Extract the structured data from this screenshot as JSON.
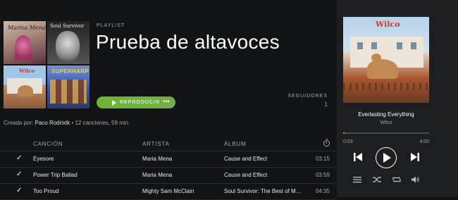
{
  "playlist": {
    "type_label": "PLAYLIST",
    "title": "Prueba de altavoces",
    "play_label": "REPRODUCIR",
    "more_label": "•••",
    "followers_label": "SEGUIDORES",
    "followers_count": "1",
    "created_prefix": "Creada por:",
    "owner": "Paco Rodrixtk",
    "summary": "• 12 canciones, 59 min",
    "covers": [
      {
        "text": "Marisa Mena"
      },
      {
        "text": "Soul Survivor"
      },
      {
        "text": "Wilco"
      },
      {
        "text": "SUPERHARPS"
      }
    ]
  },
  "table": {
    "headers": {
      "song": "CANCIÓN",
      "artist": "ARTISTA",
      "album": "ÁLBUM"
    },
    "rows": [
      {
        "check": "✓",
        "song": "Eyesore",
        "artist": "Maria Mena",
        "album": "Cause and Effect",
        "duration": "03:15"
      },
      {
        "check": "✓",
        "song": "Power Trip Ballad",
        "artist": "Maria Mena",
        "album": "Cause and Effect",
        "duration": "03:59"
      },
      {
        "check": "✓",
        "song": "Too Proud",
        "artist": "Mighty Sam McClain",
        "album": "Soul Survivor: The Best of M...",
        "duration": "04:35"
      }
    ]
  },
  "now_playing": {
    "art_logo": "Wilco",
    "title": "Everlasting Everything",
    "artist": "Wilco",
    "current_time": "0:03",
    "total_time": "4:00",
    "progress": 0.02
  },
  "colors": {
    "accent": "#6fb33b",
    "background": "#121314",
    "panel": "#1d1e20"
  },
  "icons": [
    "clock-icon",
    "previous-icon",
    "play-icon",
    "next-icon",
    "queue-icon",
    "shuffle-icon",
    "repeat-icon",
    "volume-icon",
    "check-icon",
    "more-icon"
  ]
}
